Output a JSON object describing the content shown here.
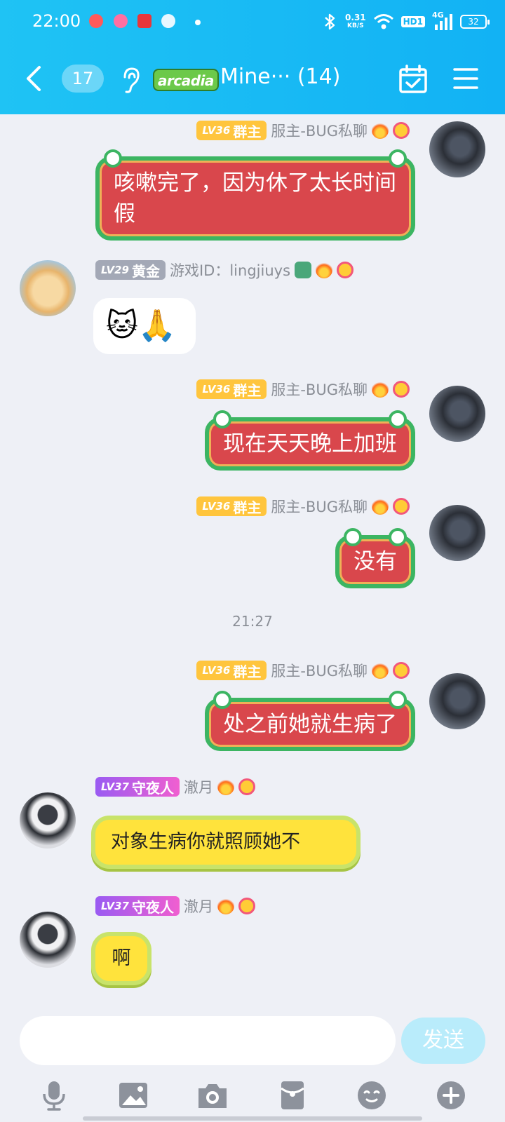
{
  "status_bar": {
    "time": "22:00",
    "net_speed": "0.31",
    "net_unit": "KB/S",
    "hd_label": "HD1",
    "signal_label": "4G",
    "battery": "32",
    "app_icons": [
      "app-icon-1",
      "app-icon-2",
      "app-icon-3",
      "app-icon-4"
    ],
    "app_colors": [
      "#ff5a5a",
      "#ff6fa1",
      "#e8363a",
      "#3cc8f7"
    ]
  },
  "header": {
    "unread_count": "17",
    "group_badge": "arcadia",
    "group_title": "Mine··· (14)",
    "accent_color": "#12b2f4"
  },
  "messages": [
    {
      "side": "right",
      "level": "LV36",
      "role": "群主",
      "name": "服主-BUG私聊",
      "text": "咳嗽完了，因为休了太长时间假"
    },
    {
      "side": "left",
      "level": "LV29",
      "role": "黄金",
      "name": "游戏ID：lingjiuys",
      "text": "🐱🙏"
    },
    {
      "side": "right",
      "level": "LV36",
      "role": "群主",
      "name": "服主-BUG私聊",
      "text": "现在天天晚上加班"
    },
    {
      "side": "right",
      "level": "LV36",
      "role": "群主",
      "name": "服主-BUG私聊",
      "text": "没有"
    },
    {
      "side": "right",
      "level": "LV36",
      "role": "群主",
      "name": "服主-BUG私聊",
      "text": "处之前她就生病了"
    },
    {
      "side": "left",
      "level": "LV37",
      "role": "守夜人",
      "name": "澈月",
      "text": "对象生病你就照顾她不"
    },
    {
      "side": "left",
      "level": "LV37",
      "role": "守夜人",
      "name": "澈月",
      "text": "啊"
    }
  ],
  "timestamp": "21:27",
  "input": {
    "placeholder": "",
    "send_label": "发送"
  },
  "toolbar": [
    "mic-icon",
    "image-icon",
    "camera-icon",
    "red-packet-icon",
    "emoji-icon",
    "plus-icon"
  ]
}
